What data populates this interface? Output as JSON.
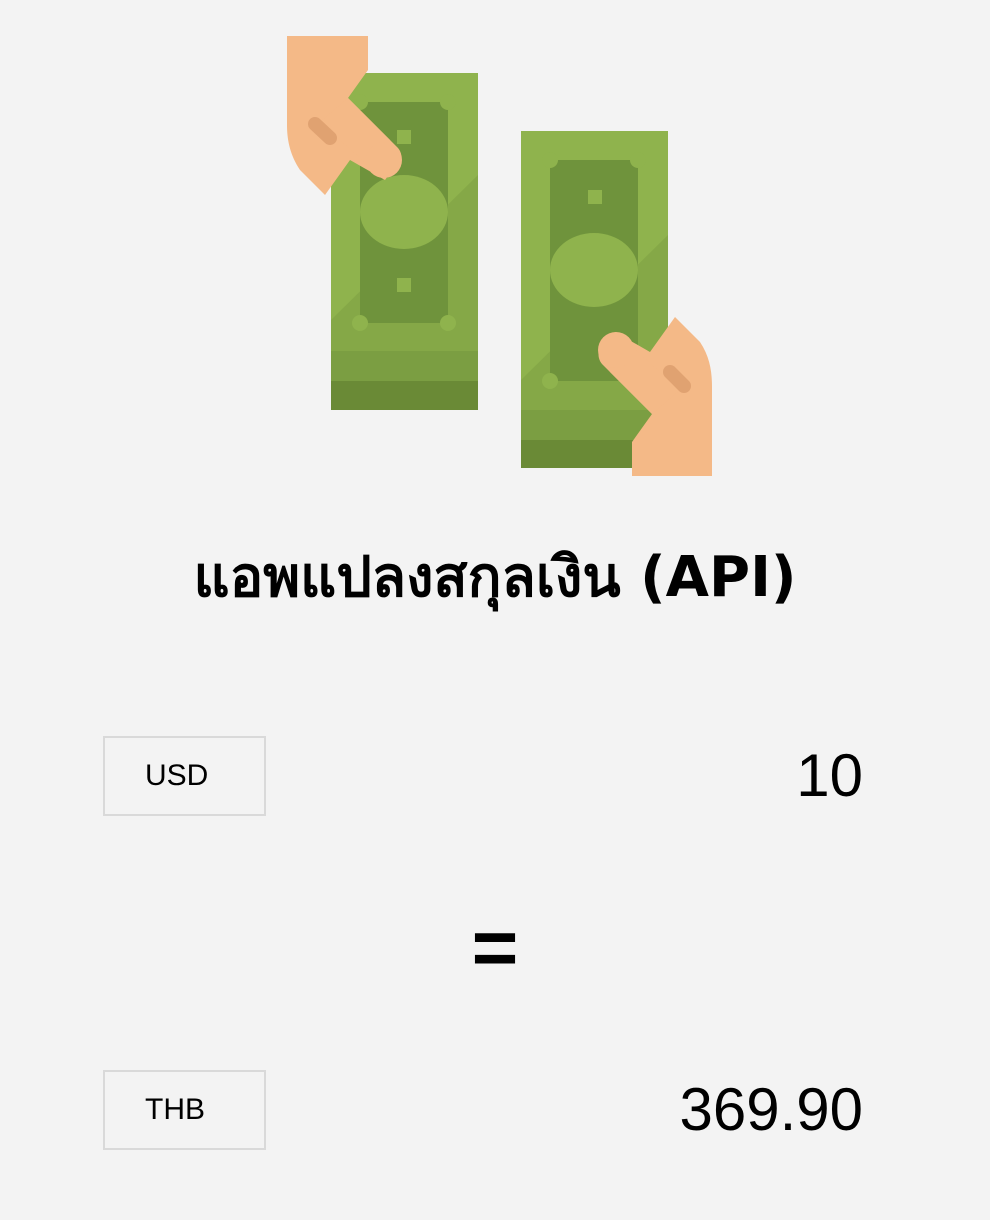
{
  "app": {
    "title": "แอพแปลงสกุลเงิน (API)"
  },
  "hero": {
    "icon": "money-exchange-icon",
    "colors": {
      "bill_light": "#8fb34d",
      "bill_dark": "#6f933c",
      "bill_stack": "#6a8a36",
      "hand": "#f4b987",
      "hand_shadow": "#e0a271"
    }
  },
  "converter": {
    "from": {
      "currency": "USD",
      "amount": "10"
    },
    "equals_sign": "=",
    "to": {
      "currency": "THB",
      "amount": "369.90"
    }
  },
  "theme": {
    "background": "#f3f3f3",
    "select_border": "#d9d9d9",
    "text": "#000000"
  }
}
